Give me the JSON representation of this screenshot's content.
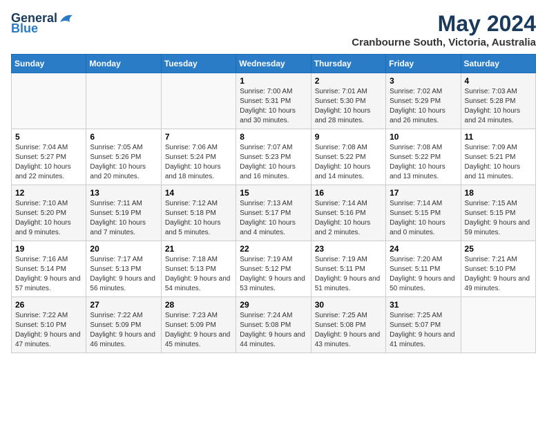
{
  "header": {
    "logo_general": "General",
    "logo_blue": "Blue",
    "month": "May 2024",
    "location": "Cranbourne South, Victoria, Australia"
  },
  "weekdays": [
    "Sunday",
    "Monday",
    "Tuesday",
    "Wednesday",
    "Thursday",
    "Friday",
    "Saturday"
  ],
  "weeks": [
    [
      {
        "day": "",
        "sunrise": "",
        "sunset": "",
        "daylight": ""
      },
      {
        "day": "",
        "sunrise": "",
        "sunset": "",
        "daylight": ""
      },
      {
        "day": "",
        "sunrise": "",
        "sunset": "",
        "daylight": ""
      },
      {
        "day": "1",
        "sunrise": "Sunrise: 7:00 AM",
        "sunset": "Sunset: 5:31 PM",
        "daylight": "Daylight: 10 hours and 30 minutes."
      },
      {
        "day": "2",
        "sunrise": "Sunrise: 7:01 AM",
        "sunset": "Sunset: 5:30 PM",
        "daylight": "Daylight: 10 hours and 28 minutes."
      },
      {
        "day": "3",
        "sunrise": "Sunrise: 7:02 AM",
        "sunset": "Sunset: 5:29 PM",
        "daylight": "Daylight: 10 hours and 26 minutes."
      },
      {
        "day": "4",
        "sunrise": "Sunrise: 7:03 AM",
        "sunset": "Sunset: 5:28 PM",
        "daylight": "Daylight: 10 hours and 24 minutes."
      }
    ],
    [
      {
        "day": "5",
        "sunrise": "Sunrise: 7:04 AM",
        "sunset": "Sunset: 5:27 PM",
        "daylight": "Daylight: 10 hours and 22 minutes."
      },
      {
        "day": "6",
        "sunrise": "Sunrise: 7:05 AM",
        "sunset": "Sunset: 5:26 PM",
        "daylight": "Daylight: 10 hours and 20 minutes."
      },
      {
        "day": "7",
        "sunrise": "Sunrise: 7:06 AM",
        "sunset": "Sunset: 5:24 PM",
        "daylight": "Daylight: 10 hours and 18 minutes."
      },
      {
        "day": "8",
        "sunrise": "Sunrise: 7:07 AM",
        "sunset": "Sunset: 5:23 PM",
        "daylight": "Daylight: 10 hours and 16 minutes."
      },
      {
        "day": "9",
        "sunrise": "Sunrise: 7:08 AM",
        "sunset": "Sunset: 5:22 PM",
        "daylight": "Daylight: 10 hours and 14 minutes."
      },
      {
        "day": "10",
        "sunrise": "Sunrise: 7:08 AM",
        "sunset": "Sunset: 5:22 PM",
        "daylight": "Daylight: 10 hours and 13 minutes."
      },
      {
        "day": "11",
        "sunrise": "Sunrise: 7:09 AM",
        "sunset": "Sunset: 5:21 PM",
        "daylight": "Daylight: 10 hours and 11 minutes."
      }
    ],
    [
      {
        "day": "12",
        "sunrise": "Sunrise: 7:10 AM",
        "sunset": "Sunset: 5:20 PM",
        "daylight": "Daylight: 10 hours and 9 minutes."
      },
      {
        "day": "13",
        "sunrise": "Sunrise: 7:11 AM",
        "sunset": "Sunset: 5:19 PM",
        "daylight": "Daylight: 10 hours and 7 minutes."
      },
      {
        "day": "14",
        "sunrise": "Sunrise: 7:12 AM",
        "sunset": "Sunset: 5:18 PM",
        "daylight": "Daylight: 10 hours and 5 minutes."
      },
      {
        "day": "15",
        "sunrise": "Sunrise: 7:13 AM",
        "sunset": "Sunset: 5:17 PM",
        "daylight": "Daylight: 10 hours and 4 minutes."
      },
      {
        "day": "16",
        "sunrise": "Sunrise: 7:14 AM",
        "sunset": "Sunset: 5:16 PM",
        "daylight": "Daylight: 10 hours and 2 minutes."
      },
      {
        "day": "17",
        "sunrise": "Sunrise: 7:14 AM",
        "sunset": "Sunset: 5:15 PM",
        "daylight": "Daylight: 10 hours and 0 minutes."
      },
      {
        "day": "18",
        "sunrise": "Sunrise: 7:15 AM",
        "sunset": "Sunset: 5:15 PM",
        "daylight": "Daylight: 9 hours and 59 minutes."
      }
    ],
    [
      {
        "day": "19",
        "sunrise": "Sunrise: 7:16 AM",
        "sunset": "Sunset: 5:14 PM",
        "daylight": "Daylight: 9 hours and 57 minutes."
      },
      {
        "day": "20",
        "sunrise": "Sunrise: 7:17 AM",
        "sunset": "Sunset: 5:13 PM",
        "daylight": "Daylight: 9 hours and 56 minutes."
      },
      {
        "day": "21",
        "sunrise": "Sunrise: 7:18 AM",
        "sunset": "Sunset: 5:13 PM",
        "daylight": "Daylight: 9 hours and 54 minutes."
      },
      {
        "day": "22",
        "sunrise": "Sunrise: 7:19 AM",
        "sunset": "Sunset: 5:12 PM",
        "daylight": "Daylight: 9 hours and 53 minutes."
      },
      {
        "day": "23",
        "sunrise": "Sunrise: 7:19 AM",
        "sunset": "Sunset: 5:11 PM",
        "daylight": "Daylight: 9 hours and 51 minutes."
      },
      {
        "day": "24",
        "sunrise": "Sunrise: 7:20 AM",
        "sunset": "Sunset: 5:11 PM",
        "daylight": "Daylight: 9 hours and 50 minutes."
      },
      {
        "day": "25",
        "sunrise": "Sunrise: 7:21 AM",
        "sunset": "Sunset: 5:10 PM",
        "daylight": "Daylight: 9 hours and 49 minutes."
      }
    ],
    [
      {
        "day": "26",
        "sunrise": "Sunrise: 7:22 AM",
        "sunset": "Sunset: 5:10 PM",
        "daylight": "Daylight: 9 hours and 47 minutes."
      },
      {
        "day": "27",
        "sunrise": "Sunrise: 7:22 AM",
        "sunset": "Sunset: 5:09 PM",
        "daylight": "Daylight: 9 hours and 46 minutes."
      },
      {
        "day": "28",
        "sunrise": "Sunrise: 7:23 AM",
        "sunset": "Sunset: 5:09 PM",
        "daylight": "Daylight: 9 hours and 45 minutes."
      },
      {
        "day": "29",
        "sunrise": "Sunrise: 7:24 AM",
        "sunset": "Sunset: 5:08 PM",
        "daylight": "Daylight: 9 hours and 44 minutes."
      },
      {
        "day": "30",
        "sunrise": "Sunrise: 7:25 AM",
        "sunset": "Sunset: 5:08 PM",
        "daylight": "Daylight: 9 hours and 43 minutes."
      },
      {
        "day": "31",
        "sunrise": "Sunrise: 7:25 AM",
        "sunset": "Sunset: 5:07 PM",
        "daylight": "Daylight: 9 hours and 41 minutes."
      },
      {
        "day": "",
        "sunrise": "",
        "sunset": "",
        "daylight": ""
      }
    ]
  ]
}
